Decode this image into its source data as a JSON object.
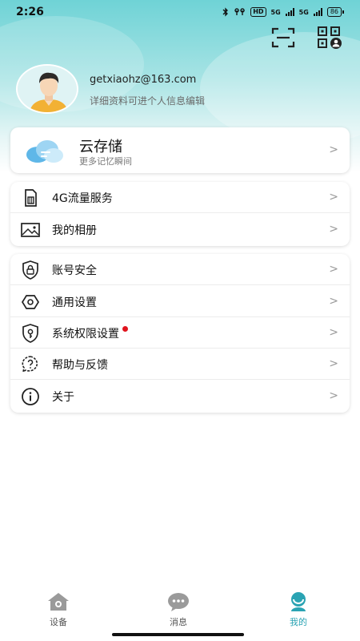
{
  "status_bar": {
    "time": "2:26",
    "hd": "HD",
    "net1": "5G",
    "net2": "5G",
    "battery": "86"
  },
  "header": {
    "scan_icon": "scan-icon",
    "qr_icon": "qr-code-icon"
  },
  "profile": {
    "email": "getxiaohz@163.com",
    "hint": "详细资料可进个人信息编辑"
  },
  "cloud": {
    "title": "云存储",
    "subtitle": "更多记忆瞬间",
    "icon": "cloud-icon"
  },
  "menu_group_1": [
    {
      "label": "4G流量服务",
      "icon": "sim-card-icon"
    },
    {
      "label": "我的相册",
      "icon": "photo-album-icon"
    }
  ],
  "menu_group_2": [
    {
      "label": "账号安全",
      "icon": "shield-lock-icon"
    },
    {
      "label": "通用设置",
      "icon": "hexagon-settings-icon"
    },
    {
      "label": "系统权限设置",
      "icon": "shield-key-icon",
      "badge": true
    },
    {
      "label": "帮助与反馈",
      "icon": "help-bubble-icon"
    },
    {
      "label": "关于",
      "icon": "info-icon"
    }
  ],
  "tabs": [
    {
      "label": "设备",
      "icon": "home-icon",
      "active": false
    },
    {
      "label": "消息",
      "icon": "chat-bubble-icon",
      "active": false
    },
    {
      "label": "我的",
      "icon": "profile-icon",
      "active": true
    }
  ],
  "colors": {
    "accent": "#2aa3b3",
    "badge": "#e0141e",
    "header_gradient_top": "#6fd3d6"
  },
  "chevron": ">"
}
